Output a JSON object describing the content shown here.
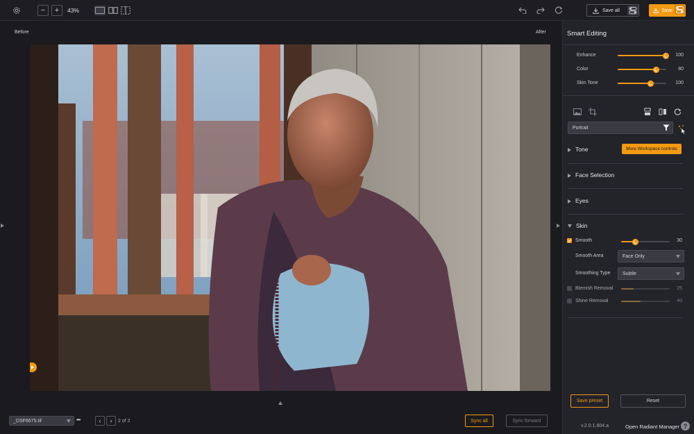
{
  "toolbar": {
    "zoom": "43%",
    "save_all_label": "Save all",
    "save_label": "Save"
  },
  "canvas": {
    "before_label": "Before",
    "after_label": "After"
  },
  "footer": {
    "file_name": "_DSF6675.tif",
    "more": "•••",
    "page_counter": "2 of 2",
    "sync_all_label": "Sync all",
    "sync_forward_label": "Sync forward"
  },
  "panel": {
    "title": "Smart Editing",
    "sliders": [
      {
        "label": "Enhance",
        "value": 100
      },
      {
        "label": "Color",
        "value": 80
      },
      {
        "label": "Skin Tone",
        "value": 100
      }
    ],
    "preset_select": "Portrait",
    "tooltip": "More Workspace controls",
    "sections": {
      "tone": "Tone",
      "face_selection": "Face Selection",
      "eyes": "Eyes",
      "skin": "Skin"
    },
    "skin": {
      "smooth_label": "Smooth",
      "smooth_value": 30,
      "smooth_area_label": "Smooth Area",
      "smooth_area_value": "Face Only",
      "smoothing_type_label": "Smoothing Type",
      "smoothing_type_value": "Subtle",
      "blemish_label": "Blemish Removal",
      "blemish_value": 25,
      "shine_label": "Shine Removal",
      "shine_value": 40
    },
    "save_preset_label": "Save preset",
    "reset_label": "Reset",
    "version": "v.2.0.1.604.a",
    "manager_label": "Open Radiant Manager",
    "help": "?"
  },
  "colors": {
    "accent": "#f39a12",
    "panel_bg": "#23232a",
    "app_bg": "#1b1b1f"
  }
}
